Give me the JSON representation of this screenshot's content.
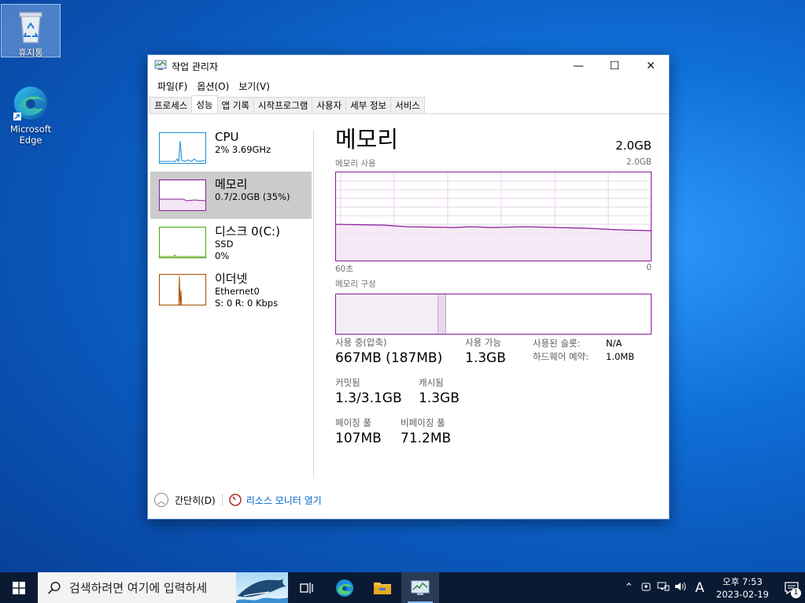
{
  "desktop": {
    "icons": [
      {
        "label": "휴지통"
      },
      {
        "label_line1": "Microsoft",
        "label_line2": "Edge"
      }
    ]
  },
  "window": {
    "title": "작업 관리자",
    "controls": {
      "minimize": "—",
      "maximize": "☐",
      "close": "✕"
    },
    "menu": [
      "파일(F)",
      "옵션(O)",
      "보기(V)"
    ],
    "tabs": [
      "프로세스",
      "성능",
      "앱 기록",
      "시작프로그램",
      "사용자",
      "세부 정보",
      "서비스"
    ],
    "active_tab": "성능"
  },
  "sidebar": {
    "items": [
      {
        "name": "CPU",
        "line1": "2% 3.69GHz",
        "line2": "",
        "color": "#1f8dd6"
      },
      {
        "name": "메모리",
        "line1": "0.7/2.0GB (35%)",
        "line2": "",
        "color": "#8b1a9a"
      },
      {
        "name": "디스크 0(C:)",
        "line1": "SSD",
        "line2": "0%",
        "color": "#4da60c"
      },
      {
        "name": "이더넷",
        "line1": "Ethernet0",
        "line2": "S: 0 R: 0 Kbps",
        "color": "#a74f01"
      }
    ],
    "selected": "메모리"
  },
  "memory": {
    "title": "메모리",
    "total": "2.0GB",
    "usage_label": "메모리 사용",
    "usage_max": "2.0GB",
    "time_left": "60초",
    "time_right": "0",
    "composition_label": "메모리 구성",
    "usage_fraction": 0.35,
    "composition": {
      "in_use": 0.326,
      "modified": 0.025
    },
    "stats": {
      "in_use": {
        "label": "사용 중(압축)",
        "value": "667MB (187MB)"
      },
      "available": {
        "label": "사용 가능",
        "value": "1.3GB"
      },
      "slots": {
        "label": "사용된 슬롯:",
        "value": "N/A"
      },
      "hw_reserved": {
        "label": "하드웨어 예약:",
        "value": "1.0MB"
      },
      "committed": {
        "label": "커밋됨",
        "value": "1.3/3.1GB"
      },
      "cached": {
        "label": "캐시됨",
        "value": "1.3GB"
      },
      "paged_pool": {
        "label": "페이징 풀",
        "value": "107MB"
      },
      "nonpaged_pool": {
        "label": "비페이징 풀",
        "value": "71.2MB"
      }
    }
  },
  "footer": {
    "fewer_details": "간단히(D)",
    "resource_monitor": "리소스 모니터 열기"
  },
  "taskbar": {
    "search_placeholder": "검색하려면 여기에 입력하세",
    "ime": "A",
    "clock_time": "오후 7:53",
    "clock_date": "2023-02-19",
    "notification_count": "1"
  }
}
